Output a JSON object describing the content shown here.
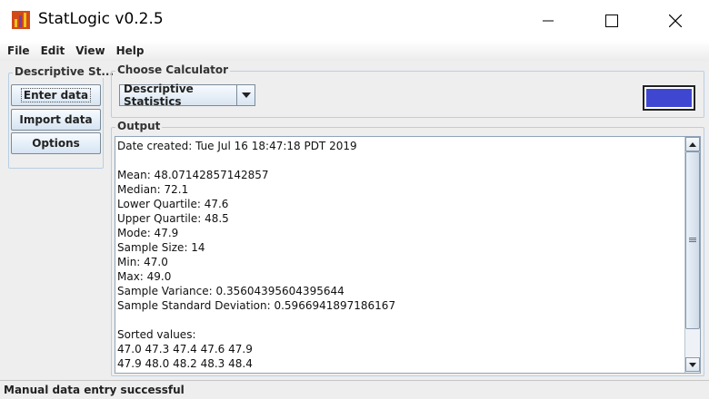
{
  "window": {
    "title": "StatLogic v0.2.5",
    "icon": "bar-chart-app-icon"
  },
  "menu": [
    {
      "label": "File"
    },
    {
      "label": "Edit"
    },
    {
      "label": "View"
    },
    {
      "label": "Help"
    }
  ],
  "sidebar": {
    "group_label": "Descriptive St...",
    "buttons": [
      {
        "label": "Enter data"
      },
      {
        "label": "Import data"
      },
      {
        "label": "Options"
      }
    ]
  },
  "calculator": {
    "group_label": "Choose Calculator",
    "selected": "Descriptive Statistics",
    "color": "#3f47d1"
  },
  "output": {
    "group_label": "Output",
    "text": "Date created: Tue Jul 16 18:47:18 PDT 2019\n\nMean: 48.07142857142857\nMedian: 72.1\nLower Quartile: 47.6\nUpper Quartile: 48.5\nMode: 47.9\nSample Size: 14\nMin: 47.0\nMax: 49.0\nSample Variance: 0.35604395604395644\nSample Standard Deviation: 0.5966941897186167\n\nSorted values:\n47.0 47.3 47.4 47.6 47.9\n47.9 48.0 48.2 48.3 48.4"
  },
  "status": {
    "text": "Manual data entry successful"
  },
  "colors": {
    "accent_border": "#b8cfe5",
    "panel_bg": "#eeeeee"
  }
}
